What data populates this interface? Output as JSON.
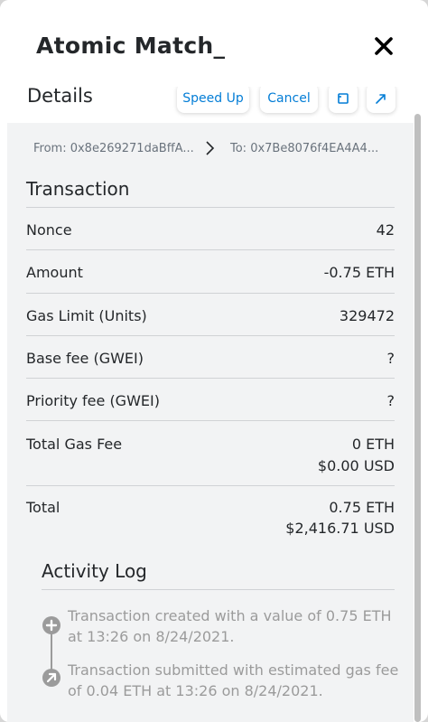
{
  "modal": {
    "title": "Atomic Match_"
  },
  "details": {
    "title": "Details",
    "speed_up_label": "Speed Up",
    "cancel_label": "Cancel",
    "accent_color": "#037dd6"
  },
  "addresses": {
    "from": "From: 0x8e269271daBffA...",
    "to": "To: 0x7Be8076f4EA4A4..."
  },
  "transaction": {
    "title": "Transaction",
    "rows": [
      {
        "label": "Nonce",
        "value": "42"
      },
      {
        "label": "Amount",
        "value": "-0.75 ETH"
      },
      {
        "label": "Gas Limit (Units)",
        "value": "329472"
      },
      {
        "label": "Base fee (GWEI)",
        "value": "?"
      },
      {
        "label": "Priority fee (GWEI)",
        "value": "?"
      },
      {
        "label": "Total Gas Fee",
        "value": "0 ETH",
        "value2": "$0.00 USD"
      },
      {
        "label": "Total",
        "value": "0.75 ETH",
        "value2": "$2,416.71 USD"
      }
    ]
  },
  "activity": {
    "title": "Activity Log",
    "entries": [
      {
        "icon": "plus-icon",
        "text": "Transaction created with a value of 0.75 ETH at 13:26 on 8/24/2021."
      },
      {
        "icon": "arrow-up-right-icon",
        "text": "Transaction submitted with estimated gas fee of 0.04 ETH at 13:26 on 8/24/2021."
      }
    ]
  }
}
